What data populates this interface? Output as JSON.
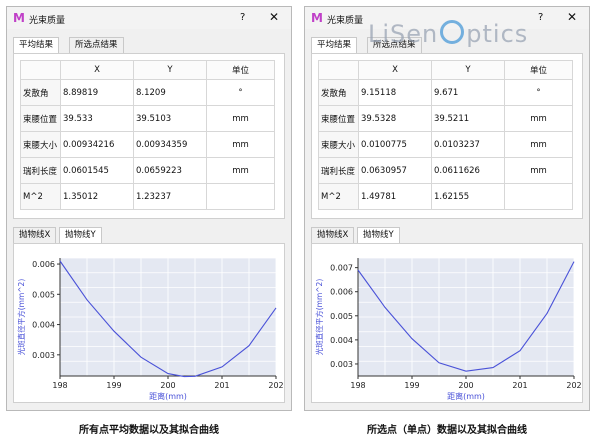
{
  "windows": [
    {
      "title": "光束质量",
      "help": "?",
      "close": "✕",
      "tabs": [
        "平均结果",
        "所选点结果"
      ],
      "table": {
        "headers": [
          "",
          "X",
          "Y",
          "单位"
        ],
        "rows": [
          {
            "label": "发散角",
            "x": "8.89819",
            "y": "8.1209",
            "unit": "°"
          },
          {
            "label": "束腰位置",
            "x": "39.533",
            "y": "39.5103",
            "unit": "mm"
          },
          {
            "label": "束腰大小",
            "x": "0.00934216",
            "y": "0.00934359",
            "unit": "mm"
          },
          {
            "label": "瑞利长度",
            "x": "0.0601545",
            "y": "0.0659223",
            "unit": "mm"
          },
          {
            "label": "M^2",
            "x": "1.35012",
            "y": "1.23237",
            "unit": ""
          }
        ]
      },
      "chart_tabs": [
        "抛物线X",
        "抛物线Y"
      ],
      "caption": "所有点平均数据以及其拟合曲线"
    },
    {
      "title": "光束质量",
      "help": "?",
      "close": "✕",
      "tabs": [
        "平均结果",
        "所选点结果"
      ],
      "table": {
        "headers": [
          "",
          "X",
          "Y",
          "单位"
        ],
        "rows": [
          {
            "label": "发散角",
            "x": "9.15118",
            "y": "9.671",
            "unit": "°"
          },
          {
            "label": "束腰位置",
            "x": "39.5328",
            "y": "39.5211",
            "unit": "mm"
          },
          {
            "label": "束腰大小",
            "x": "0.0100775",
            "y": "0.0103237",
            "unit": "mm"
          },
          {
            "label": "瑞利长度",
            "x": "0.0630957",
            "y": "0.0611626",
            "unit": "mm"
          },
          {
            "label": "M^2",
            "x": "1.49781",
            "y": "1.62155",
            "unit": ""
          }
        ]
      },
      "chart_tabs": [
        "抛物线X",
        "抛物线Y"
      ],
      "caption": "所选点（单点）数据以及其拟合曲线"
    }
  ],
  "watermark": {
    "part1": "LiSen",
    "part2": "ptics"
  },
  "colors": {
    "curve": "#4a52d8",
    "accent": "#c040c8",
    "plot_bg": "#e4e8f2",
    "watermark_ring": "#4a9ad8"
  },
  "chart_data": [
    {
      "type": "line",
      "title": "",
      "xlabel": "距离(mm)",
      "ylabel": "光斑直径平方(mm^2)",
      "xlim": [
        198,
        202
      ],
      "ylim": [
        0.0023,
        0.0062
      ],
      "xticks": [
        198,
        199,
        200,
        201,
        202
      ],
      "yticks": [
        0.003,
        0.004,
        0.005,
        0.006
      ],
      "grid": true,
      "series": [
        {
          "x": [
            198,
            198.5,
            199,
            199.5,
            200,
            200.3,
            200.5,
            201,
            201.5,
            202
          ],
          "y": [
            0.0061,
            0.00482,
            0.00378,
            0.00292,
            0.00238,
            0.00228,
            0.00229,
            0.0026,
            0.0033,
            0.00455
          ]
        }
      ]
    },
    {
      "type": "line",
      "title": "",
      "xlabel": "距离(mm)",
      "ylabel": "光斑直径平方(mm^2)",
      "xlim": [
        198,
        202
      ],
      "ylim": [
        0.0025,
        0.0074
      ],
      "xticks": [
        198,
        199,
        200,
        201,
        202
      ],
      "yticks": [
        0.003,
        0.004,
        0.005,
        0.006,
        0.007
      ],
      "grid": true,
      "series": [
        {
          "x": [
            198,
            198.5,
            199,
            199.5,
            200,
            200.5,
            201,
            201.5,
            202
          ],
          "y": [
            0.0069,
            0.00535,
            0.00405,
            0.00305,
            0.0027,
            0.00285,
            0.00355,
            0.0051,
            0.00725
          ]
        }
      ]
    }
  ]
}
